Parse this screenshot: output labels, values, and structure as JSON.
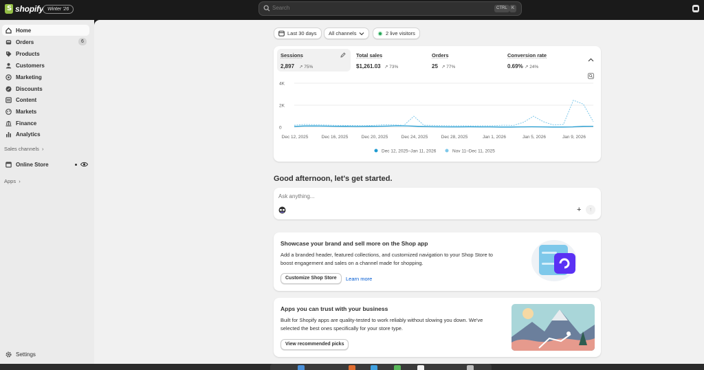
{
  "topbar": {
    "brand": "shopify",
    "edition": "Winter '26",
    "search": {
      "placeholder": "Search",
      "shortcut_ctrl": "CTRL",
      "shortcut_key": "K"
    }
  },
  "sidebar": {
    "items": [
      {
        "label": "Home",
        "icon": "home-icon",
        "active": true
      },
      {
        "label": "Orders",
        "icon": "inbox-icon",
        "badge": "6"
      },
      {
        "label": "Products",
        "icon": "tag-icon"
      },
      {
        "label": "Customers",
        "icon": "person-icon"
      },
      {
        "label": "Marketing",
        "icon": "target-icon"
      },
      {
        "label": "Discounts",
        "icon": "discount-icon"
      },
      {
        "label": "Content",
        "icon": "content-icon"
      },
      {
        "label": "Markets",
        "icon": "globe-icon"
      },
      {
        "label": "Finance",
        "icon": "bank-icon"
      },
      {
        "label": "Analytics",
        "icon": "chart-bar-icon"
      }
    ],
    "sales_channels_label": "Sales channels",
    "online_store_label": "Online Store",
    "apps_label": "Apps",
    "settings_label": "Settings"
  },
  "filters": {
    "date_range": "Last 30 days",
    "channels": "All channels",
    "live_visitors": "2 live visitors"
  },
  "metrics": [
    {
      "title": "Sessions",
      "value": "2,897",
      "change": "75%",
      "direction": "up",
      "selected": true
    },
    {
      "title": "Total sales",
      "value": "$1,261.03",
      "change": "73%",
      "direction": "up"
    },
    {
      "title": "Orders",
      "value": "25",
      "change": "77%",
      "direction": "up"
    },
    {
      "title": "Conversion rate",
      "value": "0.69%",
      "change": "24%",
      "direction": "up"
    }
  ],
  "chart_data": {
    "type": "line",
    "y_ticks": [
      "4K",
      "2K",
      "0"
    ],
    "ylim": [
      0,
      4000
    ],
    "x_ticks": [
      "Dec 12, 2025",
      "Dec 16, 2025",
      "Dec 20, 2025",
      "Dec 24, 2025",
      "Dec 28, 2025",
      "Jan 1, 2026",
      "Jan 5, 2026",
      "Jan 9, 2026"
    ],
    "series": [
      {
        "name": "Dec 12, 2025–Jan 11, 2026",
        "color": "#1f9bd1",
        "style": "solid",
        "values": [
          70,
          110,
          120,
          100,
          90,
          80,
          70,
          80,
          90,
          100,
          130,
          120,
          80,
          60,
          40,
          30,
          30,
          40,
          30,
          30,
          20,
          20,
          30,
          40,
          30,
          20,
          20,
          30,
          80,
          90
        ]
      },
      {
        "name": "Nov 11–Dec 11, 2025",
        "color": "#7ec8ea",
        "style": "dashed",
        "values": [
          180,
          250,
          230,
          200,
          170,
          160,
          150,
          140,
          170,
          220,
          210,
          170,
          1000,
          180,
          160,
          150,
          130,
          130,
          120,
          130,
          140,
          180,
          160,
          450,
          1000,
          500,
          200,
          250,
          2450,
          2100,
          500
        ]
      }
    ],
    "grid": true,
    "legend": "bottom-center"
  },
  "greeting": "Good afternoon, let's get started.",
  "ask": {
    "placeholder": "Ask anything..."
  },
  "promo_shop": {
    "title": "Showcase your brand and sell more on the Shop app",
    "body": "Add a branded header, featured collections, and customized navigation to your Shop Store to boost engagement and sales on a channel made for shopping.",
    "primary_button": "Customize Shop Store",
    "link": "Learn more"
  },
  "promo_apps": {
    "title": "Apps you can trust with your business",
    "body": "Built for Shopify apps are quality-tested to work reliably without slowing you down. We've selected the best ones specifically for your store type.",
    "button": "View recommended picks"
  }
}
